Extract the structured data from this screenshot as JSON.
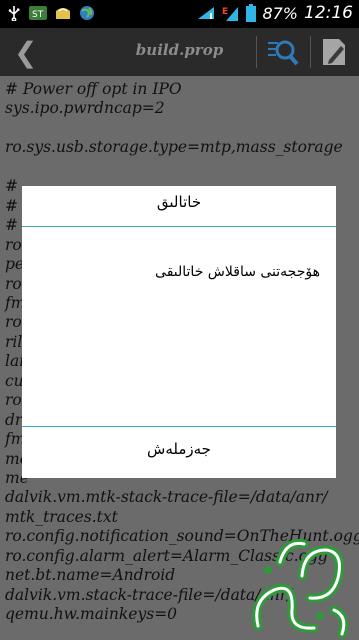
{
  "statusbar": {
    "battery_pct": "87%",
    "time": "12:16",
    "icons": [
      "usb-icon",
      "signal-bars-icon",
      "bag-icon",
      "globe-icon",
      "wifi-icon",
      "edge-signal-icon",
      "battery-icon"
    ]
  },
  "actionbar": {
    "back_glyph": "❮",
    "title": "build.prop",
    "icons": [
      "search-list-icon",
      "edit-icon"
    ]
  },
  "editor": {
    "lines": [
      "# Power off opt in IPO",
      "sys.ipo.pwrdncap=2",
      "",
      "ro.sys.usb.storage.type=mtp,mass_storage",
      "",
      "#",
      "# A",
      "#",
      "ro",
      "pe",
      "ro",
      "fm",
      "ro",
      "ril",
      "lai",
      "cu",
      "ro",
      "dr",
      "fm",
      "me",
      "me",
      "dalvik.vm.mtk-stack-trace-file=/data/anr/",
      "mtk_traces.txt",
      "ro.config.notification_sound=OnTheHunt.ogg",
      "ro.config.alarm_alert=Alarm_Classic.ogg",
      "net.bt.name=Android",
      "dalvik.vm.stack-trace-file=/data/anr/",
      "qemu.hw.mainkeys=0"
    ]
  },
  "dialog": {
    "title": "خاتالىق",
    "message": "ھۆججەتنى ساقلاش خاتالىقى",
    "button_label": "جەزملەش"
  },
  "colors": {
    "background": "#6b6b6b",
    "actionbar": "#2a2a2a",
    "dialog_separator": "#3aaac8",
    "watermark": "#2e9a3a"
  }
}
